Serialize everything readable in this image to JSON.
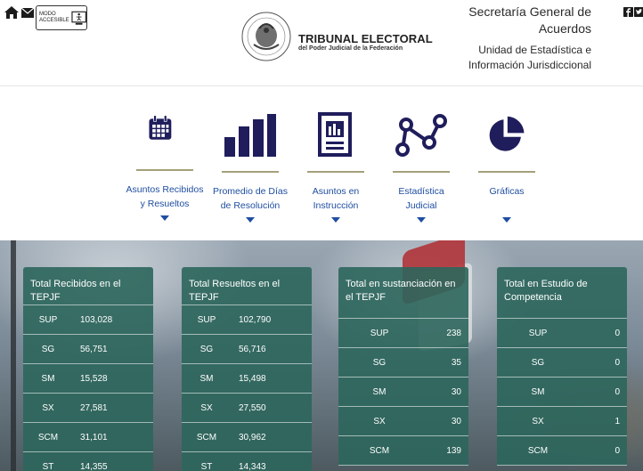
{
  "header": {
    "accesible_label_line1": "MODO",
    "accesible_label_line2": "ACCESIBLE",
    "tribunal_title": "TRIBUNAL ELECTORAL",
    "tribunal_subtitle": "del Poder Judicial de la Federación",
    "secretaria_line1": "Secretaría General de",
    "secretaria_line2": "Acuerdos",
    "unidad_line1": "Unidad de Estadística e",
    "unidad_line2": "Información Jurisdiccional",
    "icons": [
      "home-icon",
      "mail-icon",
      "accessibility-icon",
      "facebook-icon",
      "twitter-icon"
    ]
  },
  "nav": {
    "accent": "#1f4ea0",
    "items": [
      {
        "line1": "Asuntos Recibidos",
        "line2": "y Resueltos",
        "icon": "calendar-icon"
      },
      {
        "line1": "Promedio de Días",
        "line2": "de Resolución",
        "icon": "bar-chart-icon"
      },
      {
        "line1": "Asuntos en",
        "line2": "Instrucción",
        "icon": "document-chart-icon"
      },
      {
        "line1": "Estadística",
        "line2": "Judicial",
        "icon": "line-nodes-icon"
      },
      {
        "line1": "Gráficas",
        "line2": "",
        "icon": "pie-chart-icon"
      }
    ]
  },
  "cards": [
    {
      "title": "Total Recibidos en el TEPJF",
      "rows": [
        {
          "k": "SUP",
          "v": "103,028"
        },
        {
          "k": "SG",
          "v": "56,751"
        },
        {
          "k": "SM",
          "v": "15,528"
        },
        {
          "k": "SX",
          "v": "27,581"
        },
        {
          "k": "SCM",
          "v": "31,101"
        },
        {
          "k": "ST",
          "v": "14,355"
        }
      ]
    },
    {
      "title": "Total Resueltos en el TEPJF",
      "rows": [
        {
          "k": "SUP",
          "v": "102,790"
        },
        {
          "k": "SG",
          "v": "56,716"
        },
        {
          "k": "SM",
          "v": "15,498"
        },
        {
          "k": "SX",
          "v": "27,550"
        },
        {
          "k": "SCM",
          "v": "30,962"
        },
        {
          "k": "ST",
          "v": "14,343"
        }
      ]
    },
    {
      "title": "Total en sustanciación en el TEPJF",
      "rows": [
        {
          "k": "SUP",
          "v": "238"
        },
        {
          "k": "SG",
          "v": "35"
        },
        {
          "k": "SM",
          "v": "30"
        },
        {
          "k": "SX",
          "v": "30"
        },
        {
          "k": "SCM",
          "v": "139"
        }
      ]
    },
    {
      "title": "Total en Estudio de Competencia",
      "rows": [
        {
          "k": "SUP",
          "v": "0"
        },
        {
          "k": "SG",
          "v": "0"
        },
        {
          "k": "SM",
          "v": "0"
        },
        {
          "k": "SX",
          "v": "1"
        },
        {
          "k": "SCM",
          "v": "0"
        }
      ]
    }
  ]
}
